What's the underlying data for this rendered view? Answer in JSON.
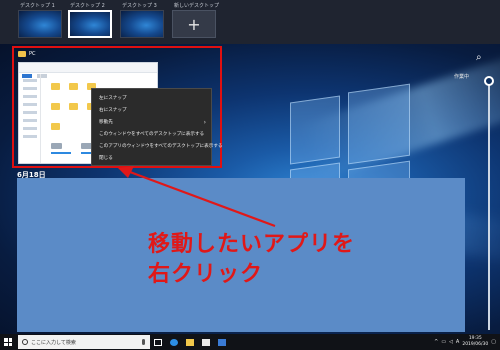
{
  "desktops": [
    {
      "label": "デスクトップ 1",
      "active": false
    },
    {
      "label": "デスクトップ 2",
      "active": true
    },
    {
      "label": "デスクトップ 3",
      "active": false
    }
  ],
  "new_desktop": {
    "label": "新しいデスクトップ",
    "plus": "+"
  },
  "window": {
    "title": "PC"
  },
  "context_menu": {
    "items": [
      {
        "label": "左にスナップ",
        "submenu": false
      },
      {
        "label": "右にスナップ",
        "submenu": false
      },
      {
        "label": "移動先",
        "submenu": true
      },
      {
        "label": "このウィンドウをすべてのデスクトップに表示する",
        "submenu": false
      },
      {
        "label": "このアプリのウィンドウをすべてのデスクトップに表示する",
        "submenu": false
      },
      {
        "label": "閉じる",
        "submenu": false
      }
    ],
    "submenu_arrow": "›"
  },
  "timeline": {
    "date": "6月18日",
    "label": "作業中"
  },
  "annotation": {
    "line1": "移動したいアプリを",
    "line2": "右クリック",
    "color": "#e01818"
  },
  "taskbar": {
    "search_placeholder": "ここに入力して検索",
    "tray_lang": "A",
    "clock_time": "19:35",
    "clock_date": "2019/06/30"
  },
  "colors": {
    "accent": "#e01010",
    "block": "#5b8bc7"
  }
}
